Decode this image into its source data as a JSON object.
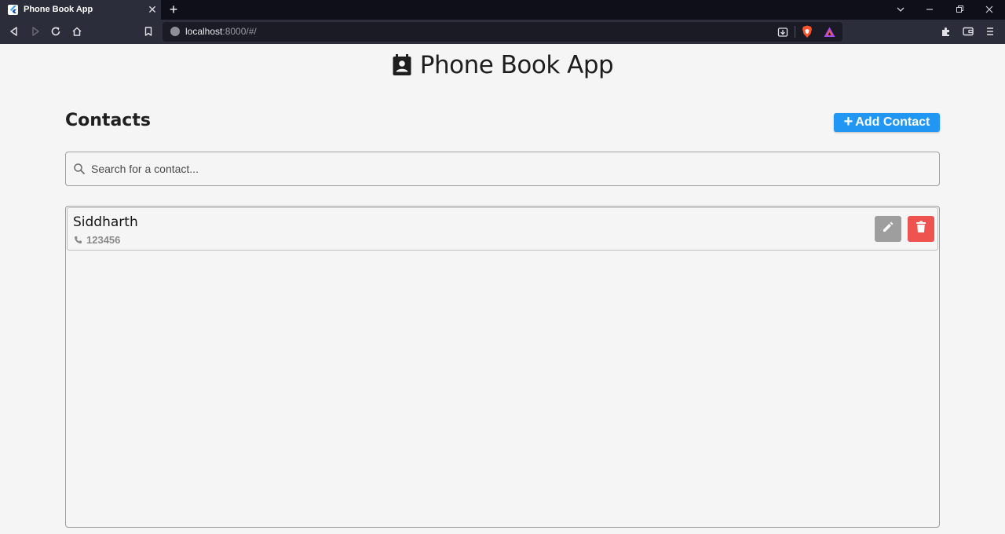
{
  "browser": {
    "tab_title": "Phone Book App",
    "url_host": "localhost",
    "url_path": ":8000/#/",
    "tab_close_glyph": "✕",
    "new_tab_glyph": "+"
  },
  "app": {
    "title": "Phone Book App",
    "icon": "contact-book-icon"
  },
  "contacts": {
    "heading": "Contacts",
    "add_button_label": "Add Contact",
    "add_button_icon": "+",
    "search_placeholder": "Search for a contact...",
    "search_value": "",
    "items": [
      {
        "name": "Siddharth",
        "phone": "123456"
      }
    ]
  },
  "colors": {
    "primary": "#2196f3",
    "edit": "#9e9e9e",
    "delete": "#ef5350",
    "background": "#f5f5f5",
    "browser_chrome": "#2b2d3a"
  },
  "icons": {
    "back": "back-icon",
    "forward": "forward-icon",
    "reload": "reload-icon",
    "home": "home-icon",
    "bookmark": "bookmark-icon",
    "search": "search-icon",
    "phone": "phone-icon",
    "edit": "pencil-icon",
    "delete": "trash-icon"
  }
}
